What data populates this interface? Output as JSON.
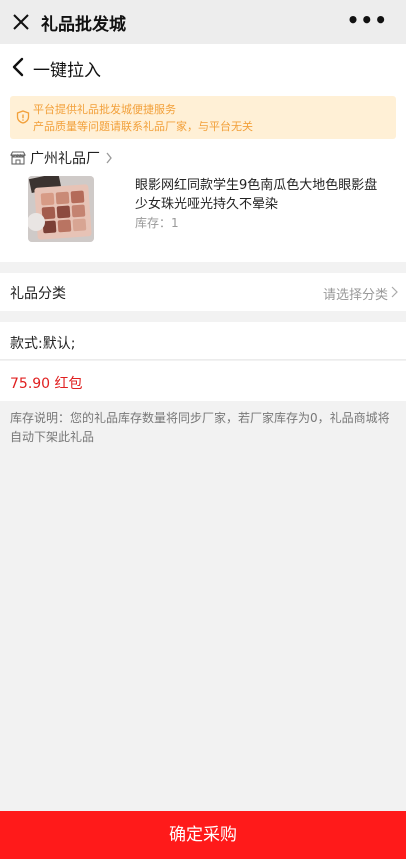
{
  "window": {
    "title": "礼品批发城",
    "close_icon": "close-icon",
    "more_icon": "more-icon"
  },
  "nav": {
    "title": "一键拉入",
    "back_icon": "back-arrow-icon"
  },
  "notice": {
    "line1": "平台提供礼品批发城便捷服务",
    "line2": "产品质量等问题请联系礼品厂家，与平台无关",
    "color": "#f2a03a",
    "background": "#fff0d6"
  },
  "shop": {
    "name": "广州礼品厂",
    "icon": "shop-icon"
  },
  "product": {
    "title": "眼影网红同款学生9色南瓜色大地色眼影盘少女珠光哑光持久不晕染",
    "stock": "库存：1"
  },
  "category": {
    "label": "礼品分类",
    "placeholder": "请选择分类"
  },
  "spec": {
    "text": "款式:默认;"
  },
  "price": {
    "text": "75.90 红包",
    "color": "#e02020"
  },
  "stock_note": "库存说明：您的礼品库存数量将同步厂家，若厂家库存为0，礼品商城将自动下架此礼品",
  "confirm_button": {
    "label": "确定采购",
    "color": "#ff1a1a"
  }
}
